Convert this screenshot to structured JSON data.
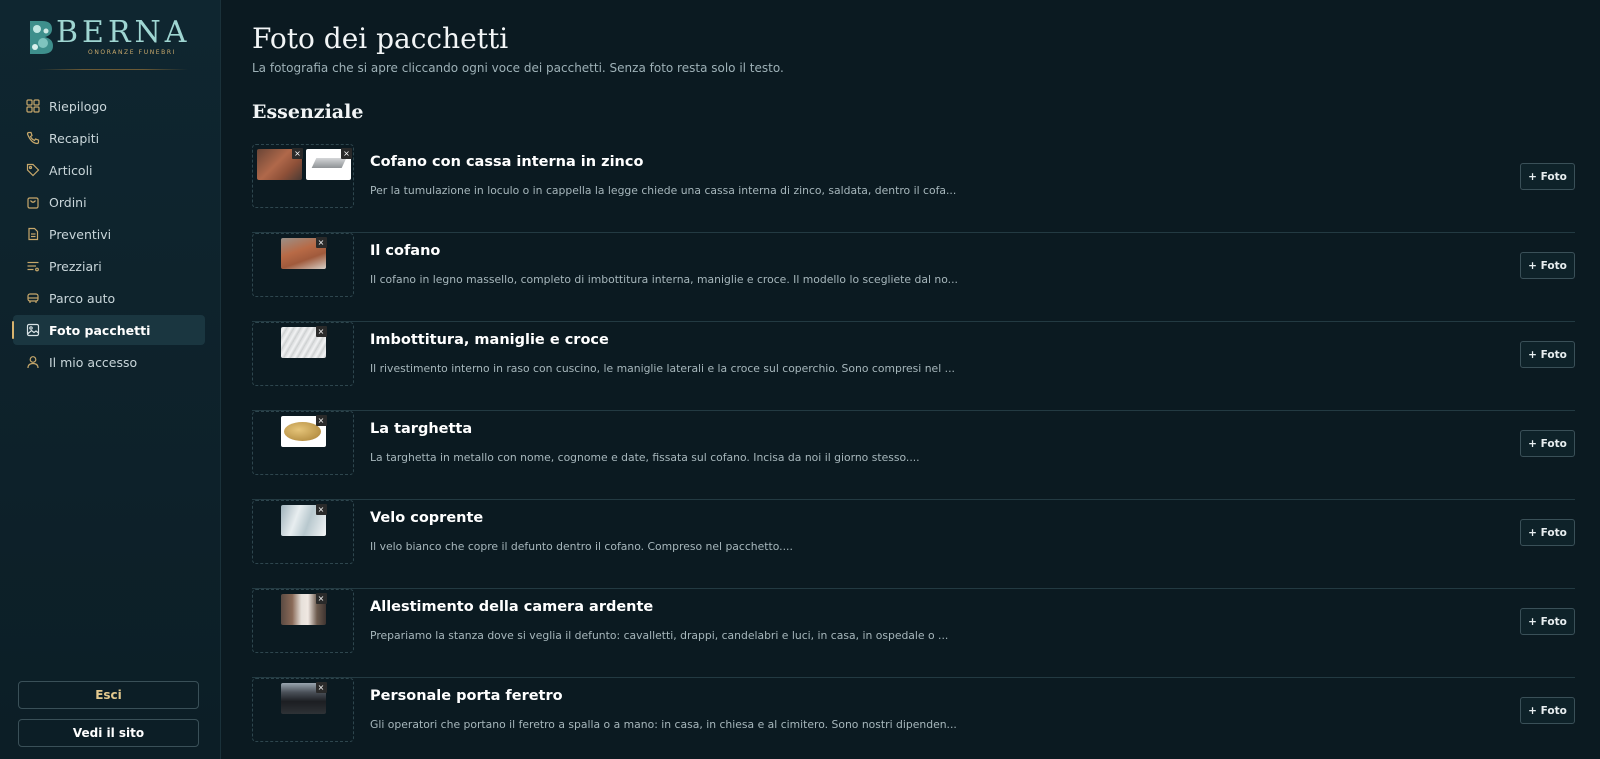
{
  "brand": {
    "name": "BERNA",
    "tagline": "ONORANZE FUNEBRI"
  },
  "nav": {
    "items": [
      {
        "label": "Riepilogo",
        "icon": "grid-icon"
      },
      {
        "label": "Recapiti",
        "icon": "phone-icon"
      },
      {
        "label": "Articoli",
        "icon": "tag-icon"
      },
      {
        "label": "Ordini",
        "icon": "bag-icon"
      },
      {
        "label": "Preventivi",
        "icon": "document-icon"
      },
      {
        "label": "Prezziari",
        "icon": "list-icon"
      },
      {
        "label": "Parco auto",
        "icon": "car-icon"
      },
      {
        "label": "Foto pacchetti",
        "icon": "image-icon",
        "active": true
      },
      {
        "label": "Il mio accesso",
        "icon": "user-icon"
      }
    ],
    "logout_label": "Esci",
    "site_label": "Vedi il sito"
  },
  "page": {
    "title": "Foto dei pacchetti",
    "subtitle": "La fotografia che si apre cliccando ogni voce dei pacchetti. Senza foto resta solo il testo."
  },
  "section": {
    "title": "Essenziale",
    "add_photo_label": "+ Foto",
    "remove_label": "×",
    "rows": [
      {
        "title": "Cofano con cassa interna in zinco",
        "desc": "Per la tumulazione in loculo o in cappella la legge chiede una cassa interna di zinco, saldata, dentro il cofa..."
      },
      {
        "title": "Il cofano",
        "desc": "Il cofano in legno massello, completo di imbottitura interna, maniglie e croce. Il modello lo scegliete dal no..."
      },
      {
        "title": "Imbottitura, maniglie e croce",
        "desc": "Il rivestimento interno in raso con cuscino, le maniglie laterali e la croce sul coperchio. Sono compresi nel ..."
      },
      {
        "title": "La targhetta",
        "desc": "La targhetta in metallo con nome, cognome e date, fissata sul cofano. Incisa da noi il giorno stesso...."
      },
      {
        "title": "Velo coprente",
        "desc": "Il velo bianco che copre il defunto dentro il cofano. Compreso nel pacchetto...."
      },
      {
        "title": "Allestimento della camera ardente",
        "desc": "Prepariamo la stanza dove si veglia il defunto: cavalletti, drappi, candelabri e luci, in casa, in ospedale o ..."
      },
      {
        "title": "Personale porta feretro",
        "desc": "Gli operatori che portano il feretro a spalla o a mano: in casa, in chiesa e al cimitero. Sono nostri dipenden..."
      }
    ]
  }
}
